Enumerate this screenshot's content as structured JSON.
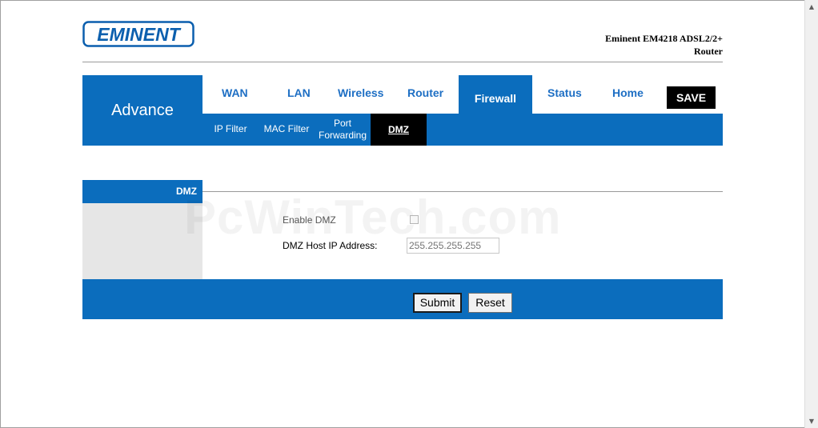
{
  "brand": {
    "logo_text": "EMINENT",
    "product_line1": "Eminent EM4218 ADSL2/2+",
    "product_line2": "Router"
  },
  "nav": {
    "section_title": "Advance",
    "tabs": [
      {
        "label": "WAN"
      },
      {
        "label": "LAN"
      },
      {
        "label": "Wireless"
      },
      {
        "label": "Router"
      },
      {
        "label": "Firewall",
        "active": true
      },
      {
        "label": "Status"
      },
      {
        "label": "Home"
      }
    ],
    "save_label": "SAVE",
    "subtabs": [
      {
        "label": "IP Filter"
      },
      {
        "label": "MAC Filter"
      },
      {
        "label_line1": "Port",
        "label_line2": "Forwarding"
      },
      {
        "label": "DMZ",
        "active": true
      }
    ]
  },
  "dmz": {
    "section_label": "DMZ",
    "enable_label": "Enable DMZ",
    "enable_checked": false,
    "host_ip_label": "DMZ Host IP Address:",
    "host_ip_placeholder": "255.255.255.255",
    "submit_label": "Submit",
    "reset_label": "Reset"
  },
  "watermark": "PcWinTech.com",
  "colors": {
    "nav_blue": "#0b6dbd",
    "tab_text": "#1e6fc4",
    "save_bg": "#000000"
  }
}
